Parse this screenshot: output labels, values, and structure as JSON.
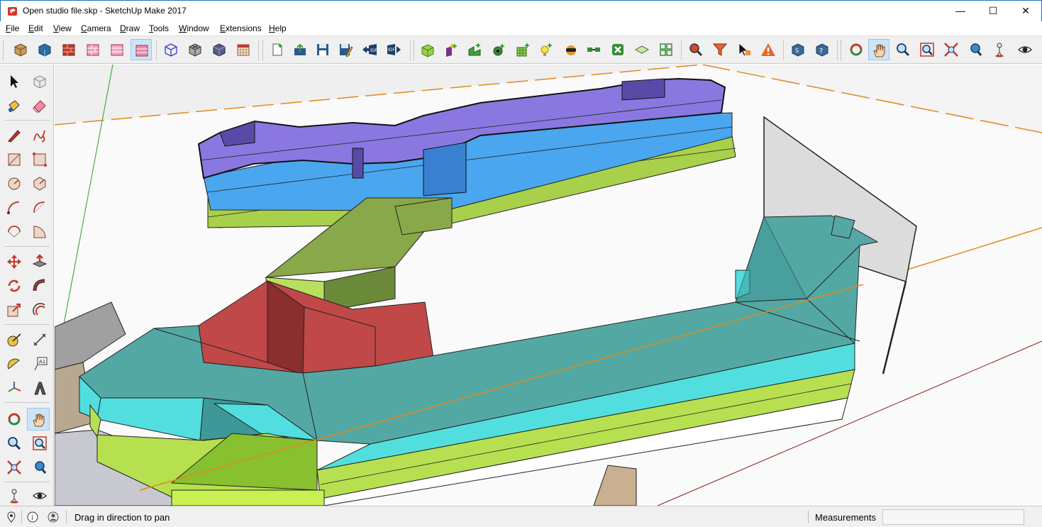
{
  "window": {
    "title": "Open studio file.skp - SketchUp Make 2017",
    "minimize": "—",
    "maximize": "☐",
    "close": "✕"
  },
  "menu": [
    {
      "accel": "F",
      "rest": "ile"
    },
    {
      "accel": "E",
      "rest": "dit"
    },
    {
      "accel": "V",
      "rest": "iew"
    },
    {
      "accel": "C",
      "rest": "amera"
    },
    {
      "accel": "D",
      "rest": "raw"
    },
    {
      "accel": "T",
      "rest": "ools"
    },
    {
      "accel": "W",
      "rest": "indow"
    },
    {
      "accel": "E",
      "rest": "xtensions"
    },
    {
      "accel": "H",
      "rest": "elp"
    }
  ],
  "toolbar_icons": [
    "xray-style-icon",
    "back-edges-style-icon",
    "wireframe-style-icon",
    "hidden-line-style-icon",
    "shaded-style-icon",
    "shaded-textures-style-icon",
    "monochrome-style-icon",
    "iso-view-icon",
    "top-view-icon",
    "front-view-icon",
    "calendar-icon",
    "new-idf-icon",
    "open-idf-icon",
    "save-idf-icon",
    "save-as-icon",
    "import-idf-icon",
    "export-idf-icon",
    "new-space-icon",
    "new-shading-icon",
    "new-interior-partition-icon",
    "new-illuminance-map-icon",
    "new-daylighting-icon",
    "new-glare-sensor-icon",
    "new-luminaire-icon",
    "new-surface-matching-icon",
    "new-loads-icon",
    "project-loose-geometry-icon",
    "info-tool-icon",
    "search-filter-icon",
    "select-tool-icon",
    "error-warning-icon",
    "openstudio-app-icon",
    "help-icon",
    "orbit-icon",
    "pan-icon",
    "zoom-icon",
    "zoom-window-icon",
    "zoom-extents-icon",
    "previous-view-icon",
    "position-camera-icon",
    "look-around-icon"
  ],
  "status": {
    "hint": "Drag in direction to pan",
    "measurements_label": "Measurements",
    "measurements_value": ""
  },
  "colors": {
    "accent": "#1b6fbf",
    "active_tool": "#cce4f7",
    "wall_purple": "#8a78e0",
    "wall_blue": "#3f9fef",
    "wall_green": "#b4e05a",
    "wall_teal": "#55a8a4",
    "wall_cyan": "#52dede",
    "wall_red": "#c0504d"
  }
}
